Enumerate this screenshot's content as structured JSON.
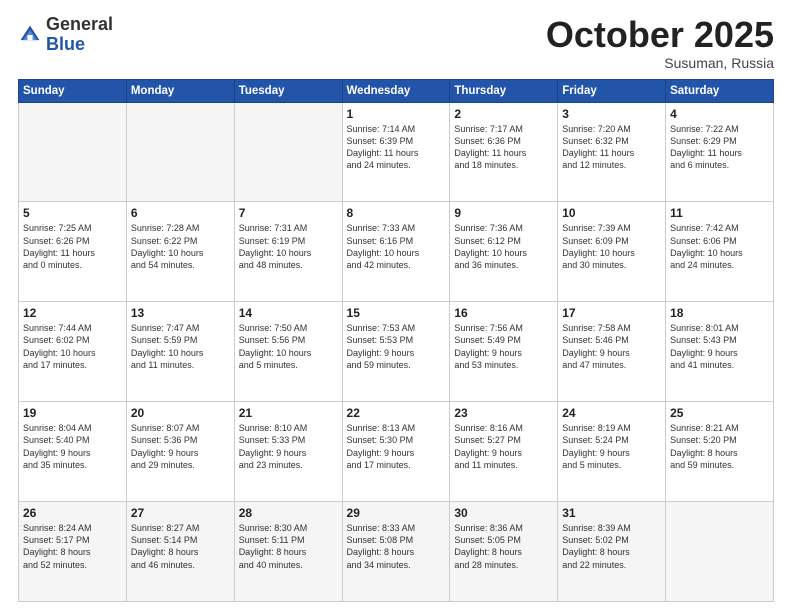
{
  "logo": {
    "general": "General",
    "blue": "Blue"
  },
  "header": {
    "month": "October 2025",
    "location": "Susuman, Russia"
  },
  "weekdays": [
    "Sunday",
    "Monday",
    "Tuesday",
    "Wednesday",
    "Thursday",
    "Friday",
    "Saturday"
  ],
  "weeks": [
    [
      {
        "day": "",
        "detail": ""
      },
      {
        "day": "",
        "detail": ""
      },
      {
        "day": "",
        "detail": ""
      },
      {
        "day": "1",
        "detail": "Sunrise: 7:14 AM\nSunset: 6:39 PM\nDaylight: 11 hours\nand 24 minutes."
      },
      {
        "day": "2",
        "detail": "Sunrise: 7:17 AM\nSunset: 6:36 PM\nDaylight: 11 hours\nand 18 minutes."
      },
      {
        "day": "3",
        "detail": "Sunrise: 7:20 AM\nSunset: 6:32 PM\nDaylight: 11 hours\nand 12 minutes."
      },
      {
        "day": "4",
        "detail": "Sunrise: 7:22 AM\nSunset: 6:29 PM\nDaylight: 11 hours\nand 6 minutes."
      }
    ],
    [
      {
        "day": "5",
        "detail": "Sunrise: 7:25 AM\nSunset: 6:26 PM\nDaylight: 11 hours\nand 0 minutes."
      },
      {
        "day": "6",
        "detail": "Sunrise: 7:28 AM\nSunset: 6:22 PM\nDaylight: 10 hours\nand 54 minutes."
      },
      {
        "day": "7",
        "detail": "Sunrise: 7:31 AM\nSunset: 6:19 PM\nDaylight: 10 hours\nand 48 minutes."
      },
      {
        "day": "8",
        "detail": "Sunrise: 7:33 AM\nSunset: 6:16 PM\nDaylight: 10 hours\nand 42 minutes."
      },
      {
        "day": "9",
        "detail": "Sunrise: 7:36 AM\nSunset: 6:12 PM\nDaylight: 10 hours\nand 36 minutes."
      },
      {
        "day": "10",
        "detail": "Sunrise: 7:39 AM\nSunset: 6:09 PM\nDaylight: 10 hours\nand 30 minutes."
      },
      {
        "day": "11",
        "detail": "Sunrise: 7:42 AM\nSunset: 6:06 PM\nDaylight: 10 hours\nand 24 minutes."
      }
    ],
    [
      {
        "day": "12",
        "detail": "Sunrise: 7:44 AM\nSunset: 6:02 PM\nDaylight: 10 hours\nand 17 minutes."
      },
      {
        "day": "13",
        "detail": "Sunrise: 7:47 AM\nSunset: 5:59 PM\nDaylight: 10 hours\nand 11 minutes."
      },
      {
        "day": "14",
        "detail": "Sunrise: 7:50 AM\nSunset: 5:56 PM\nDaylight: 10 hours\nand 5 minutes."
      },
      {
        "day": "15",
        "detail": "Sunrise: 7:53 AM\nSunset: 5:53 PM\nDaylight: 9 hours\nand 59 minutes."
      },
      {
        "day": "16",
        "detail": "Sunrise: 7:56 AM\nSunset: 5:49 PM\nDaylight: 9 hours\nand 53 minutes."
      },
      {
        "day": "17",
        "detail": "Sunrise: 7:58 AM\nSunset: 5:46 PM\nDaylight: 9 hours\nand 47 minutes."
      },
      {
        "day": "18",
        "detail": "Sunrise: 8:01 AM\nSunset: 5:43 PM\nDaylight: 9 hours\nand 41 minutes."
      }
    ],
    [
      {
        "day": "19",
        "detail": "Sunrise: 8:04 AM\nSunset: 5:40 PM\nDaylight: 9 hours\nand 35 minutes."
      },
      {
        "day": "20",
        "detail": "Sunrise: 8:07 AM\nSunset: 5:36 PM\nDaylight: 9 hours\nand 29 minutes."
      },
      {
        "day": "21",
        "detail": "Sunrise: 8:10 AM\nSunset: 5:33 PM\nDaylight: 9 hours\nand 23 minutes."
      },
      {
        "day": "22",
        "detail": "Sunrise: 8:13 AM\nSunset: 5:30 PM\nDaylight: 9 hours\nand 17 minutes."
      },
      {
        "day": "23",
        "detail": "Sunrise: 8:16 AM\nSunset: 5:27 PM\nDaylight: 9 hours\nand 11 minutes."
      },
      {
        "day": "24",
        "detail": "Sunrise: 8:19 AM\nSunset: 5:24 PM\nDaylight: 9 hours\nand 5 minutes."
      },
      {
        "day": "25",
        "detail": "Sunrise: 8:21 AM\nSunset: 5:20 PM\nDaylight: 8 hours\nand 59 minutes."
      }
    ],
    [
      {
        "day": "26",
        "detail": "Sunrise: 8:24 AM\nSunset: 5:17 PM\nDaylight: 8 hours\nand 52 minutes."
      },
      {
        "day": "27",
        "detail": "Sunrise: 8:27 AM\nSunset: 5:14 PM\nDaylight: 8 hours\nand 46 minutes."
      },
      {
        "day": "28",
        "detail": "Sunrise: 8:30 AM\nSunset: 5:11 PM\nDaylight: 8 hours\nand 40 minutes."
      },
      {
        "day": "29",
        "detail": "Sunrise: 8:33 AM\nSunset: 5:08 PM\nDaylight: 8 hours\nand 34 minutes."
      },
      {
        "day": "30",
        "detail": "Sunrise: 8:36 AM\nSunset: 5:05 PM\nDaylight: 8 hours\nand 28 minutes."
      },
      {
        "day": "31",
        "detail": "Sunrise: 8:39 AM\nSunset: 5:02 PM\nDaylight: 8 hours\nand 22 minutes."
      },
      {
        "day": "",
        "detail": ""
      }
    ]
  ]
}
